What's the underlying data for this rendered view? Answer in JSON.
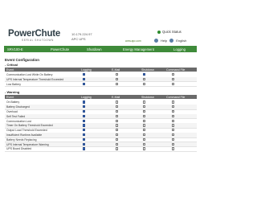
{
  "header": {
    "logo": "PowerChute",
    "logo_sub": "SERIAL SHUTDOWN",
    "device_ip": "10.179.224.97",
    "device_name": "APC UPS",
    "quick_status": "Quick Status",
    "url_text": "www.apc.com",
    "help_label": "Help",
    "language": "English"
  },
  "nav": {
    "items": [
      "SRV100-E",
      "PowerChute",
      "Shutdown",
      "Energy Management",
      "Logging"
    ]
  },
  "page_title": "Event Configuration",
  "columns": [
    "Event",
    "Logging",
    "E-Mail",
    "Shutdown",
    "Command File"
  ],
  "critical": {
    "title": "Critical",
    "rows": [
      {
        "label": "Communication Lost While On Battery",
        "checks": [
          true,
          false,
          true,
          false
        ]
      },
      {
        "label": "UPS Internal Temperature Threshold Exceeded",
        "checks": [
          true,
          false,
          false,
          false
        ]
      },
      {
        "label": "Low Battery",
        "checks": [
          true,
          false,
          false,
          false
        ]
      }
    ]
  },
  "warning": {
    "title": "Warning",
    "rows": [
      {
        "label": "On Battery",
        "checks": [
          true,
          false,
          false,
          false
        ]
      },
      {
        "label": "Battery Discharged",
        "checks": [
          true,
          false,
          false,
          false
        ]
      },
      {
        "label": "Overload",
        "checks": [
          true,
          false,
          false,
          false
        ]
      },
      {
        "label": "Self Test Failed",
        "checks": [
          true,
          false,
          false,
          false
        ]
      },
      {
        "label": "Communication Lost",
        "checks": [
          true,
          false,
          false,
          false
        ]
      },
      {
        "label": "Timer On Battery Threshold Exceeded",
        "checks": [
          true,
          false,
          false,
          false
        ]
      },
      {
        "label": "Output Load Threshold Exceeded",
        "checks": [
          true,
          false,
          false,
          false
        ]
      },
      {
        "label": "Insufficient Runtime Available",
        "checks": [
          true,
          false,
          false,
          false
        ]
      },
      {
        "label": "Battery Needs Replacing",
        "checks": [
          true,
          false,
          false,
          false
        ]
      },
      {
        "label": "UPS Internal Temperature Warning",
        "checks": [
          true,
          false,
          false,
          false
        ]
      },
      {
        "label": "UPS Board Disabled",
        "checks": [
          true,
          false,
          false,
          false
        ]
      }
    ]
  }
}
